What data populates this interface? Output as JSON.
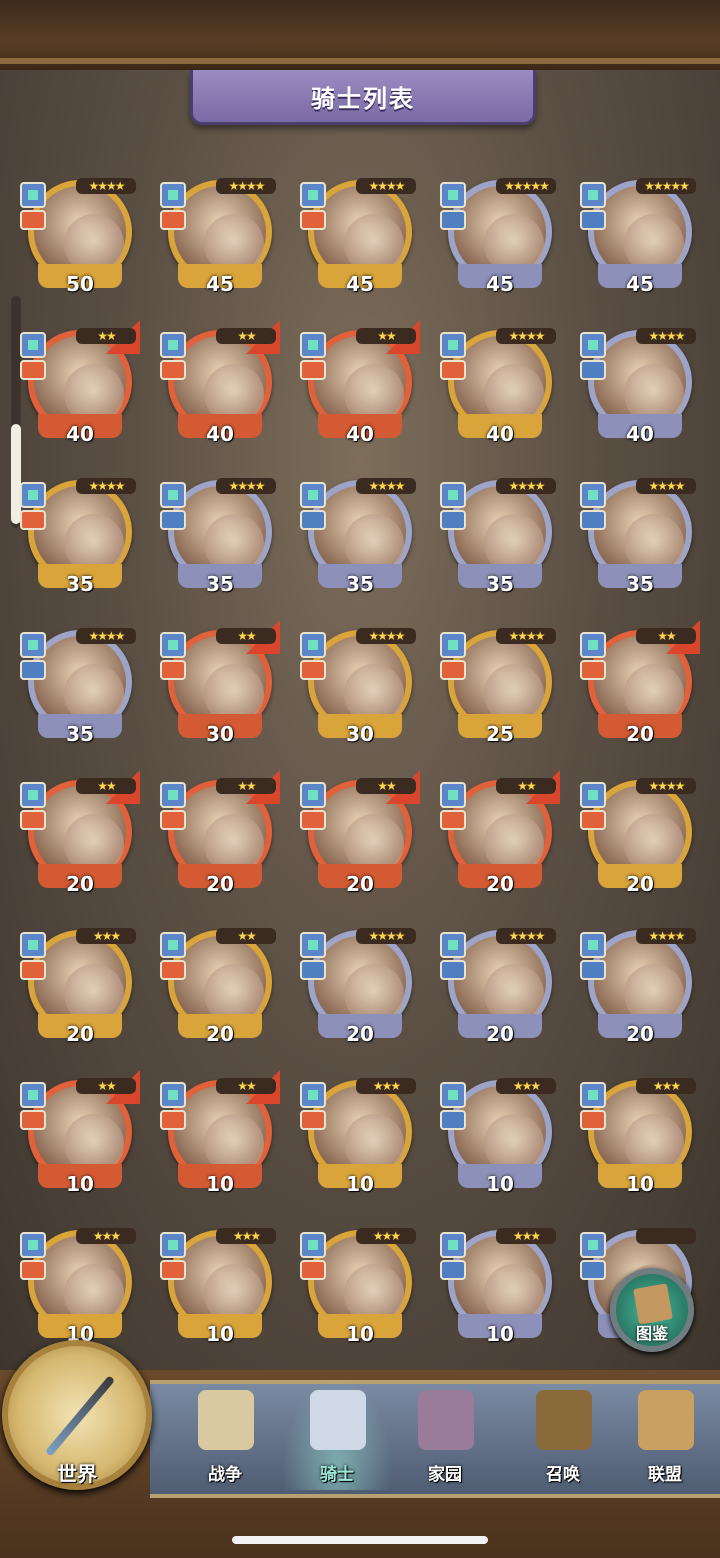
{
  "title": "骑士列表",
  "knights": [
    {
      "level": "50",
      "stars": "★★★★",
      "frame": "gold",
      "rank": false
    },
    {
      "level": "45",
      "stars": "★★★★",
      "frame": "gold",
      "rank": false
    },
    {
      "level": "45",
      "stars": "★★★★",
      "frame": "gold",
      "rank": false
    },
    {
      "level": "45",
      "stars": "★★★★★",
      "frame": "silver",
      "rank": false
    },
    {
      "level": "45",
      "stars": "★★★★★",
      "frame": "silver",
      "rank": false
    },
    {
      "level": "40",
      "stars": "★★",
      "frame": "orange",
      "rank": true
    },
    {
      "level": "40",
      "stars": "★★",
      "frame": "orange",
      "rank": true
    },
    {
      "level": "40",
      "stars": "★★",
      "frame": "orange",
      "rank": true
    },
    {
      "level": "40",
      "stars": "★★★★",
      "frame": "gold",
      "rank": false
    },
    {
      "level": "40",
      "stars": "★★★★",
      "frame": "silver",
      "rank": false
    },
    {
      "level": "35",
      "stars": "★★★★",
      "frame": "gold",
      "rank": false
    },
    {
      "level": "35",
      "stars": "★★★★",
      "frame": "silver",
      "rank": false
    },
    {
      "level": "35",
      "stars": "★★★★",
      "frame": "silver",
      "rank": false
    },
    {
      "level": "35",
      "stars": "★★★★",
      "frame": "silver",
      "rank": false
    },
    {
      "level": "35",
      "stars": "★★★★",
      "frame": "silver",
      "rank": false
    },
    {
      "level": "35",
      "stars": "★★★★",
      "frame": "silver",
      "rank": false
    },
    {
      "level": "30",
      "stars": "★★",
      "frame": "orange",
      "rank": true
    },
    {
      "level": "30",
      "stars": "★★★★",
      "frame": "gold",
      "rank": false
    },
    {
      "level": "25",
      "stars": "★★★★",
      "frame": "gold",
      "rank": false
    },
    {
      "level": "20",
      "stars": "★★",
      "frame": "orange",
      "rank": true
    },
    {
      "level": "20",
      "stars": "★★",
      "frame": "orange",
      "rank": true
    },
    {
      "level": "20",
      "stars": "★★",
      "frame": "orange",
      "rank": true
    },
    {
      "level": "20",
      "stars": "★★",
      "frame": "orange",
      "rank": true
    },
    {
      "level": "20",
      "stars": "★★",
      "frame": "orange",
      "rank": true
    },
    {
      "level": "20",
      "stars": "★★★★",
      "frame": "gold",
      "rank": false
    },
    {
      "level": "20",
      "stars": "★★★",
      "frame": "gold",
      "rank": false
    },
    {
      "level": "20",
      "stars": "★★",
      "frame": "gold",
      "rank": false
    },
    {
      "level": "20",
      "stars": "★★★★",
      "frame": "silver",
      "rank": false
    },
    {
      "level": "20",
      "stars": "★★★★",
      "frame": "silver",
      "rank": false
    },
    {
      "level": "20",
      "stars": "★★★★",
      "frame": "silver",
      "rank": false
    },
    {
      "level": "10",
      "stars": "★★",
      "frame": "orange",
      "rank": true
    },
    {
      "level": "10",
      "stars": "★★",
      "frame": "orange",
      "rank": true
    },
    {
      "level": "10",
      "stars": "★★★",
      "frame": "gold",
      "rank": false
    },
    {
      "level": "10",
      "stars": "★★★",
      "frame": "silver",
      "rank": false
    },
    {
      "level": "10",
      "stars": "★★★",
      "frame": "gold",
      "rank": false
    },
    {
      "level": "10",
      "stars": "★★★",
      "frame": "gold",
      "rank": false
    },
    {
      "level": "10",
      "stars": "★★★",
      "frame": "gold",
      "rank": false
    },
    {
      "level": "10",
      "stars": "★★★",
      "frame": "gold",
      "rank": false
    },
    {
      "level": "10",
      "stars": "★★★",
      "frame": "silver",
      "rank": false
    },
    {
      "level": "",
      "stars": "",
      "frame": "silver",
      "rank": false
    }
  ],
  "codex_button": {
    "label": "图鉴"
  },
  "nav": {
    "world": "世界",
    "items": [
      {
        "label": "战争",
        "active": false
      },
      {
        "label": "骑士",
        "active": true
      },
      {
        "label": "家园",
        "active": false
      },
      {
        "label": "召唤",
        "active": false
      },
      {
        "label": "联盟",
        "active": false
      }
    ]
  }
}
